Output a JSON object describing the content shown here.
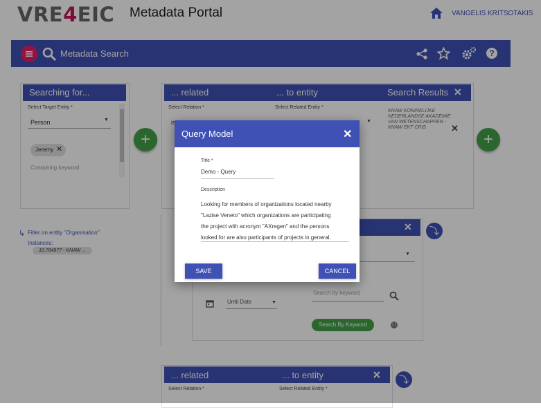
{
  "header": {
    "logo_left": "VRE",
    "logo_four": "4",
    "logo_right": "EIC",
    "app_title": "Metadata Portal",
    "user_name": "VANGELIS KRITSOTAKIS"
  },
  "toolbar": {
    "title": "Metadata Search"
  },
  "searching_panel": {
    "title": "Searching for...",
    "target_label": "Select Target Entity *",
    "target_value": "Person",
    "chip": "Jeremy",
    "keyword_placeholder": "Containing keyword"
  },
  "related_panel": {
    "related_title": "... related",
    "to_entity_title": "... to entity",
    "results_title": "Search Results",
    "relation_label": "Select Relation *",
    "relation_value": "is",
    "related_entity_label": "Select Related Entity *",
    "results_text": "KNAW KONINKLIJKE NEDERLANDSE AKADEMIE VAN WETENSCHAPPEN - KNAW EKT CRIS"
  },
  "filter": {
    "label": "Filter on entity",
    "entity": "\"Organisation\"",
    "instances_label": "Instances:",
    "instance_chip": "10.764977 - KNAW ..."
  },
  "middle_panel": {
    "until_date": "Until Date",
    "search_keyword_placeholder": "Search by keyword",
    "search_button": "Search By Keyword"
  },
  "bottom_panel": {
    "related_title": "... related",
    "to_entity_title": "... to entity",
    "relation_label": "Select Relation *",
    "related_entity_label": "Select Related Entity *"
  },
  "dialog": {
    "title": "Query Model",
    "title_label": "Title *",
    "title_value": "Demo - Query",
    "description_label": "Description",
    "description_lines": [
      "Looking for members of organizations located nearby",
      "\"Lazise Veneto\" which organizations are participating",
      "the project with acronym \"AXregen\" and the persons",
      "looked for are also participants of projects in general."
    ],
    "save_label": "SAVE",
    "cancel_label": "CANCEL"
  },
  "icons": {
    "home": "home-icon",
    "menu": "menu-icon",
    "search": "search-icon",
    "share": "share-icon",
    "star": "star-icon",
    "settings": "cogs-icon",
    "help": "help-icon",
    "add": "plus-icon",
    "close": "close-icon",
    "calendar": "calendar-icon",
    "globe": "globe-icon",
    "subdirectory": "return-arrow-icon"
  },
  "colors": {
    "primary": "#3f51b5",
    "accent": "#e91e63",
    "success": "#43a047",
    "logo_four": "#c2185b"
  }
}
